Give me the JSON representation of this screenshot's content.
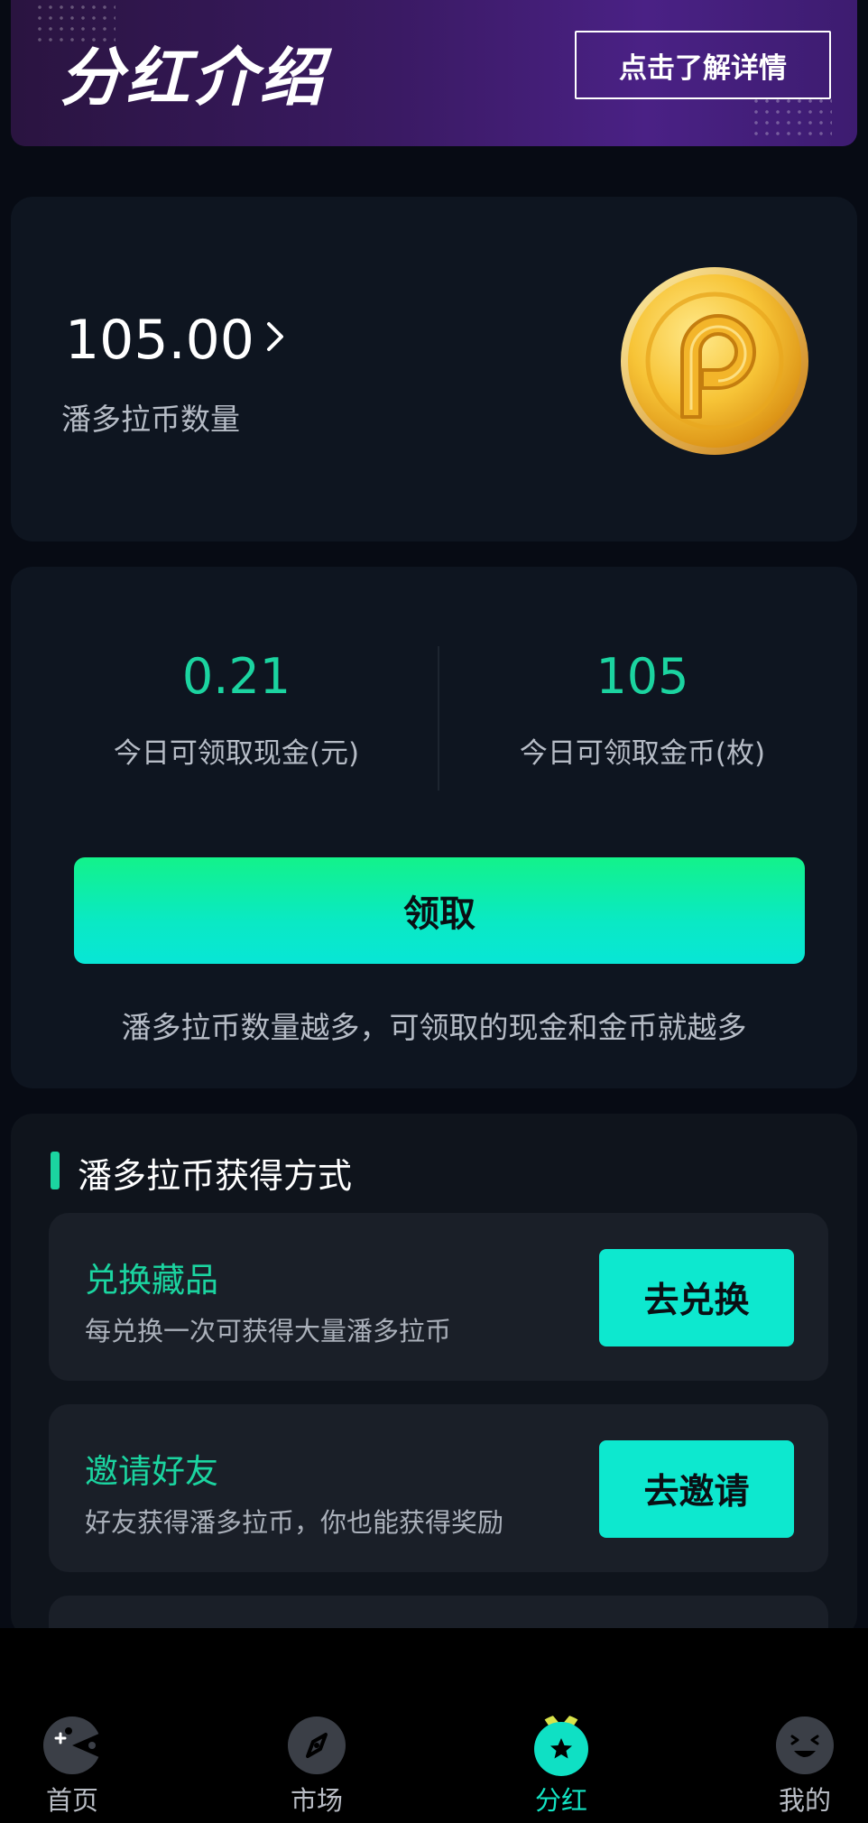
{
  "banner": {
    "title": "分红介绍",
    "details_button": "点击了解详情"
  },
  "balance": {
    "value": "105.00",
    "label": "潘多拉币数量"
  },
  "claim": {
    "cash_value": "0.21",
    "cash_label": "今日可领取现金(元)",
    "coin_value": "105",
    "coin_label": "今日可领取金币(枚)",
    "button": "领取",
    "note": "潘多拉币数量越多，可领取的现金和金币就越多"
  },
  "ways": {
    "title": "潘多拉币获得方式",
    "items": [
      {
        "title": "兑换藏品",
        "desc": "每兑换一次可获得大量潘多拉币",
        "button": "去兑换"
      },
      {
        "title": "邀请好友",
        "desc": "好友获得潘多拉币，你也能获得奖励",
        "button": "去邀请"
      }
    ]
  },
  "tabs": [
    {
      "label": "首页",
      "icon": "home-pacman-icon"
    },
    {
      "label": "市场",
      "icon": "compass-icon"
    },
    {
      "label": "分红",
      "icon": "star-medal-icon",
      "active": true
    },
    {
      "label": "我的",
      "icon": "smiley-face-icon"
    }
  ],
  "colors": {
    "accent": "#1bd4a0",
    "button_green": "#0de8cf",
    "background": "#070b14",
    "card": "#0e1520"
  }
}
